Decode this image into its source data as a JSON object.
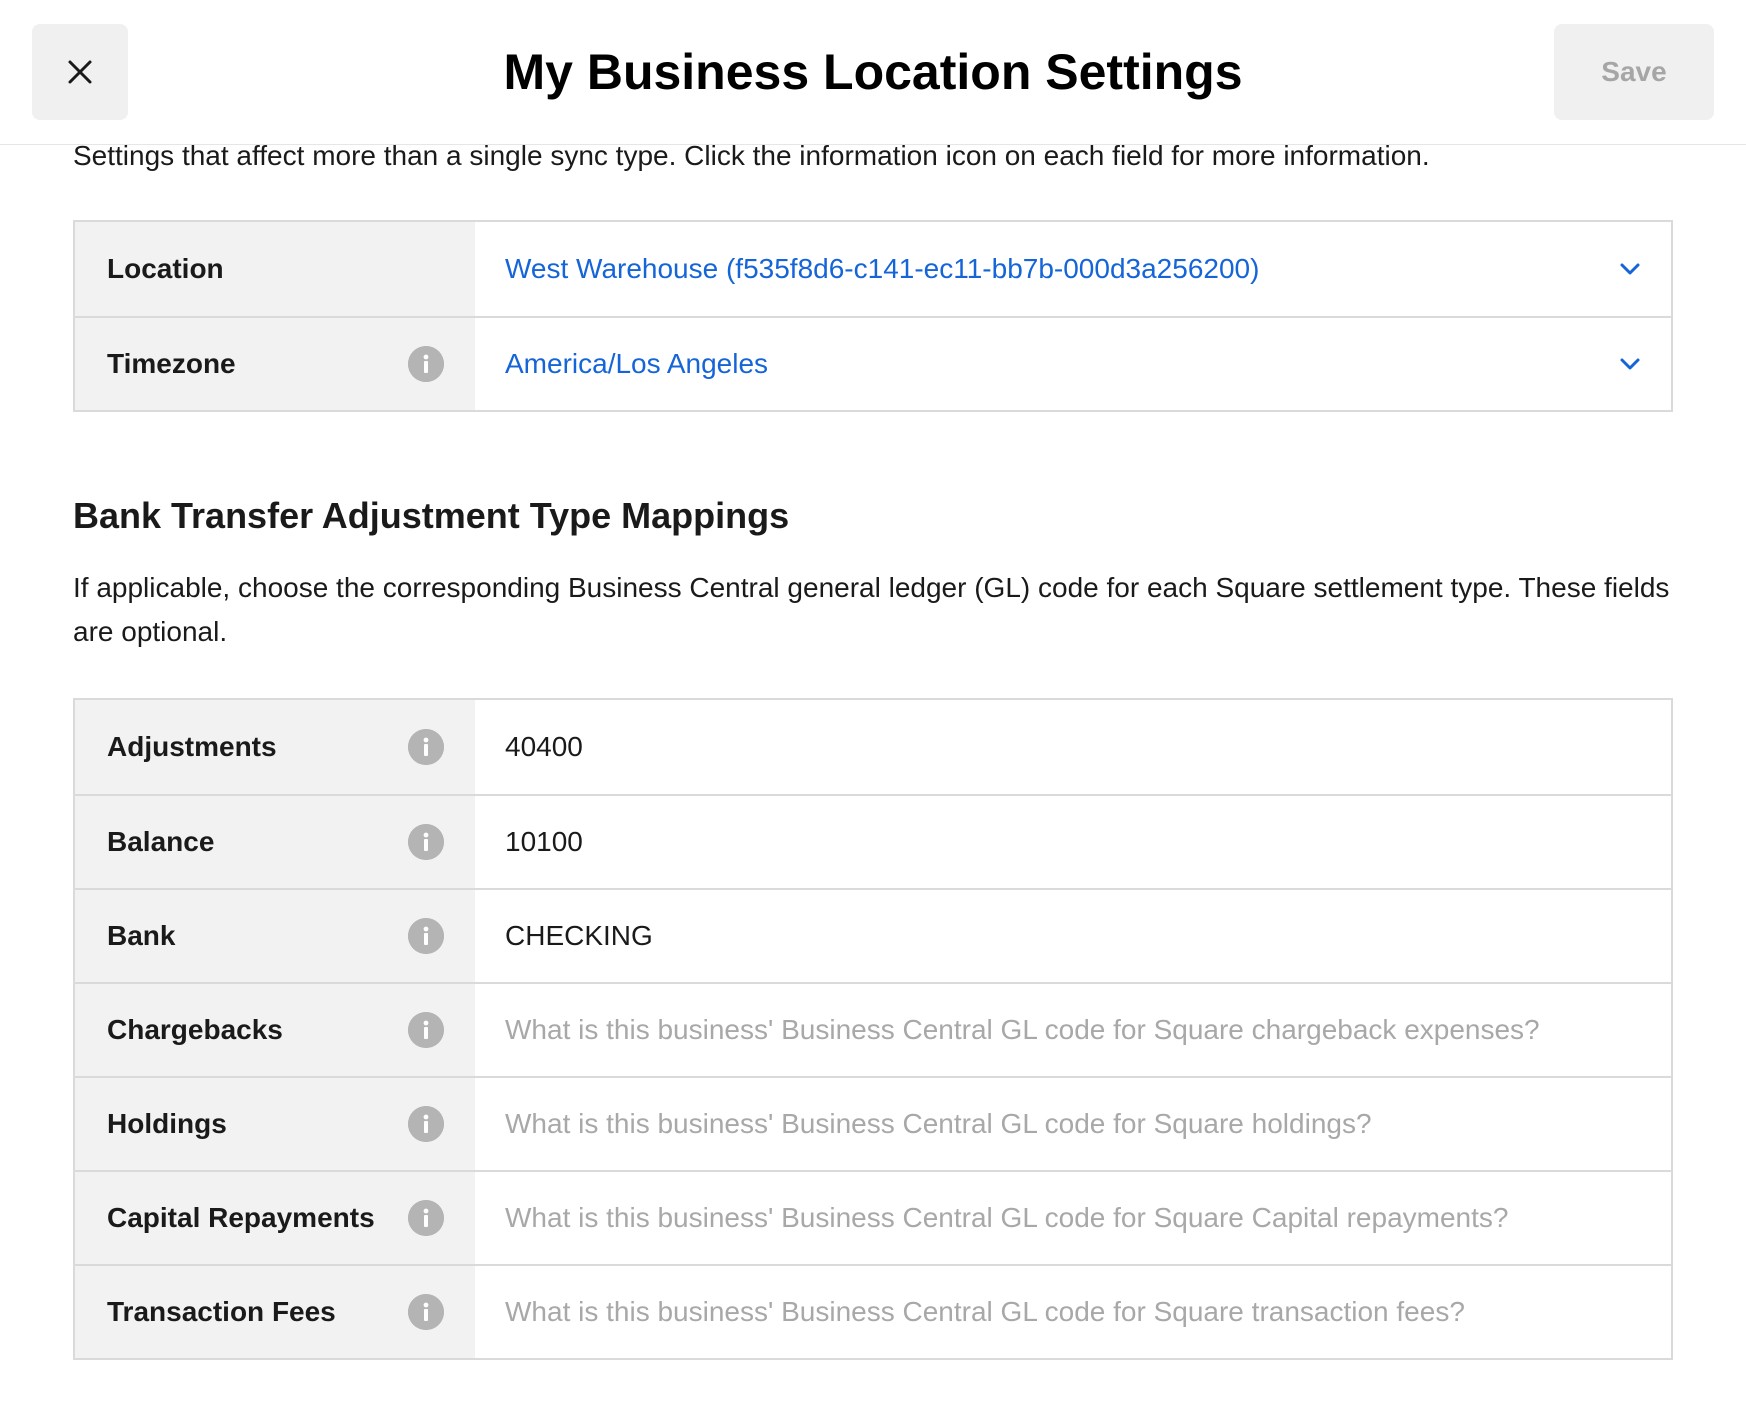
{
  "header": {
    "title": "My Business Location Settings",
    "save_label": "Save"
  },
  "intro": "Settings that affect more than a single sync type. Click the information icon on each field for more information.",
  "general_settings": {
    "rows": [
      {
        "label": "Location",
        "value": "West Warehouse (f535f8d6-c141-ec11-bb7b-000d3a256200)",
        "has_info": false
      },
      {
        "label": "Timezone",
        "value": "America/Los Angeles",
        "has_info": true
      }
    ]
  },
  "bank_transfer": {
    "title": "Bank Transfer Adjustment Type Mappings",
    "description": "If applicable, choose the corresponding Business Central general ledger (GL) code for each Square settlement type. These fields are optional.",
    "rows": [
      {
        "label": "Adjustments",
        "value": "40400",
        "placeholder": ""
      },
      {
        "label": "Balance",
        "value": "10100",
        "placeholder": ""
      },
      {
        "label": "Bank",
        "value": "CHECKING",
        "placeholder": ""
      },
      {
        "label": "Chargebacks",
        "value": "",
        "placeholder": "What is this business' Business Central GL code for Square chargeback expenses?"
      },
      {
        "label": "Holdings",
        "value": "",
        "placeholder": "What is this business' Business Central GL code for Square holdings?"
      },
      {
        "label": "Capital Repayments",
        "value": "",
        "placeholder": "What is this business' Business Central GL code for Square Capital repayments?"
      },
      {
        "label": "Transaction Fees",
        "value": "",
        "placeholder": "What is this business' Business Central GL code for Square transaction fees?"
      }
    ]
  },
  "colors": {
    "link_blue": "#1565d8",
    "label_bg": "#f2f2f2",
    "border": "#dadada",
    "placeholder": "#a8a8a8"
  }
}
